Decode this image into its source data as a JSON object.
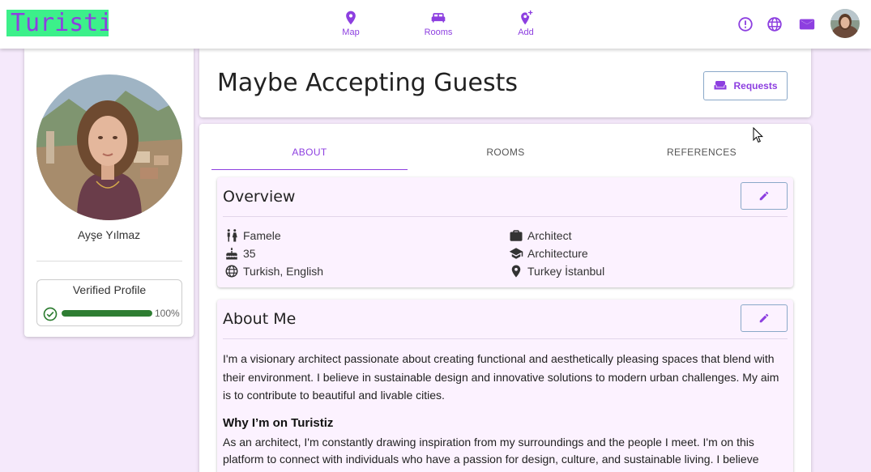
{
  "app": {
    "logo": "Turistiz"
  },
  "nav": [
    {
      "label": "Map",
      "icon": "map-pin-icon"
    },
    {
      "label": "Rooms",
      "icon": "bed-icon"
    },
    {
      "label": "Add",
      "icon": "add-location-icon"
    }
  ],
  "topbar_icons": [
    "alert-circle-icon",
    "globe-icon",
    "mail-icon",
    "avatar"
  ],
  "profile": {
    "name": "Ayşe Yılmaz",
    "verified_title": "Verified Profile",
    "verified_percent": 100,
    "verified_percent_label": "100%"
  },
  "header": {
    "title": "Maybe Accepting Guests",
    "requests_label": "Requests"
  },
  "tabs": [
    {
      "label": "ABOUT",
      "active": true
    },
    {
      "label": "ROOMS",
      "active": false
    },
    {
      "label": "REFERENCES",
      "active": false
    }
  ],
  "overview": {
    "title": "Overview",
    "left": [
      {
        "icon": "wc-gender-icon",
        "value": "Famele"
      },
      {
        "icon": "cake-icon",
        "value": "35"
      },
      {
        "icon": "globe-icon",
        "value": "Turkish, English"
      }
    ],
    "right": [
      {
        "icon": "briefcase-icon",
        "value": "Architect"
      },
      {
        "icon": "graduation-cap-icon",
        "value": "Architecture"
      },
      {
        "icon": "location-pin-icon",
        "value": "Turkey İstanbul"
      }
    ]
  },
  "about": {
    "title": "About Me",
    "text": "I'm a visionary architect passionate about creating functional and aesthetically pleasing spaces that blend with their environment. I believe in sustainable design and innovative solutions to modern urban challenges. My aim is to contribute to beautiful and livable cities.",
    "why_title": "Why I’m on Turistiz",
    "why_text": "As an architect, I'm constantly drawing inspiration from my surroundings and the people I meet. I'm on this platform to connect with individuals who have a passion for design, culture, and sustainable living. I believe"
  },
  "colors": {
    "accent": "#8d3fe0",
    "logo_bg": "#3cf08a",
    "page_bg": "#f5e9fb",
    "section_bg": "#fcf2ff",
    "progress": "#2e7d32"
  }
}
